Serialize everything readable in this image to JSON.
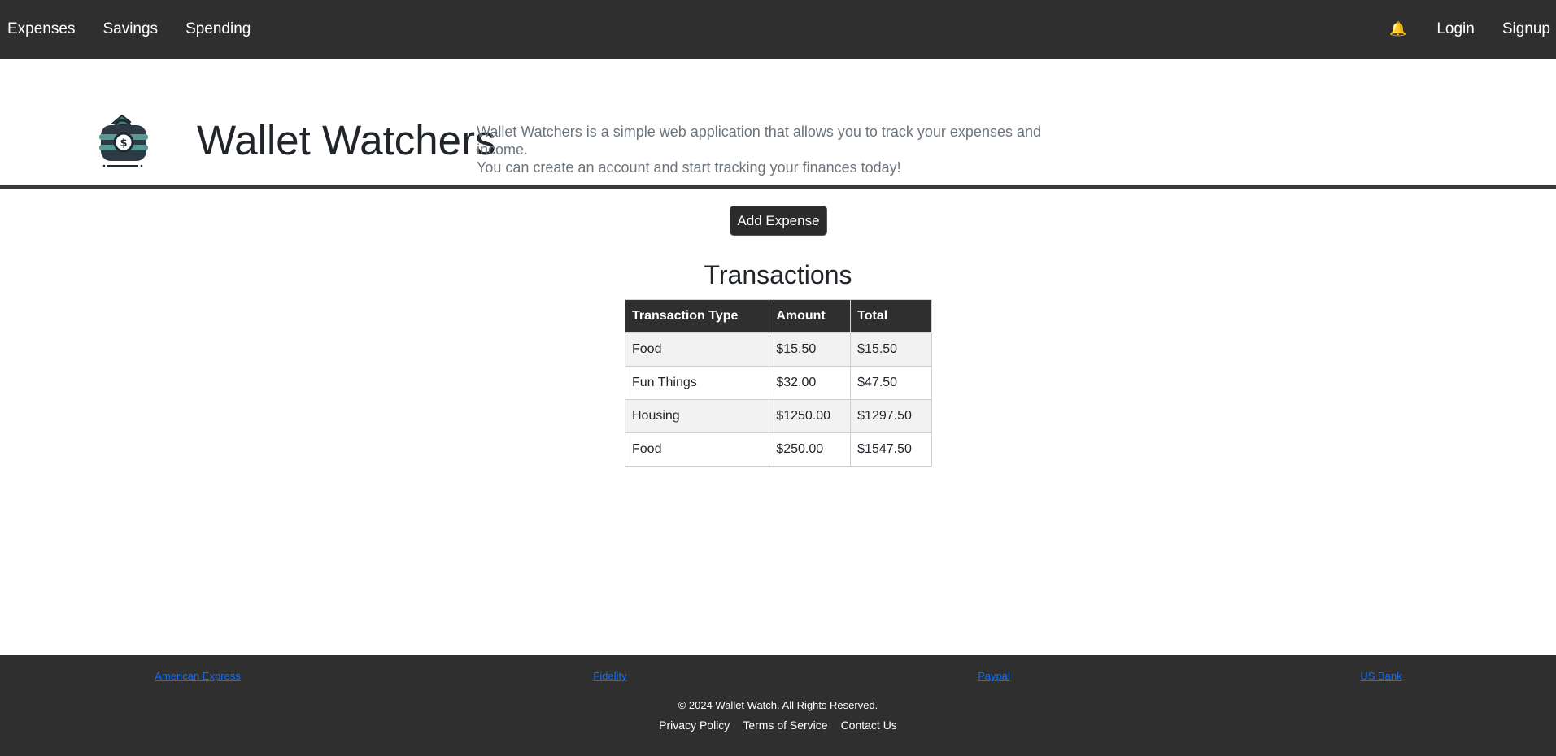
{
  "nav": {
    "left": [
      "Expenses",
      "Savings",
      "Spending"
    ],
    "bell_icon": "🔔",
    "login": "Login",
    "signup": "Signup"
  },
  "hero": {
    "title": "Wallet Watchers",
    "description_line1": "Wallet Watchers is a simple web application that allows you to track your expenses and income.",
    "description_line2": "You can create an account and start tracking your finances today!",
    "logo_icon": "wallet-icon"
  },
  "actions": {
    "add_expense": "Add Expense"
  },
  "transactions": {
    "title": "Transactions",
    "headers": [
      "Transaction Type",
      "Amount",
      "Total"
    ],
    "rows": [
      [
        "Food",
        "$15.50",
        "$15.50"
      ],
      [
        "Fun Things",
        "$32.00",
        "$47.50"
      ],
      [
        "Housing",
        "$1250.00",
        "$1297.50"
      ],
      [
        "Food",
        "$250.00",
        "$1547.50"
      ]
    ]
  },
  "footer": {
    "banks": [
      "American Express",
      "Fidelity",
      "Paypal",
      "US Bank"
    ],
    "copyright": "© 2024 Wallet Watch. All Rights Reserved.",
    "links": [
      "Privacy Policy",
      "Terms of Service",
      "Contact Us"
    ]
  },
  "colors": {
    "nav_bg": "#2f2f2f",
    "link_blue": "#0d6efd",
    "row_stripe": "#f2f2f2"
  }
}
